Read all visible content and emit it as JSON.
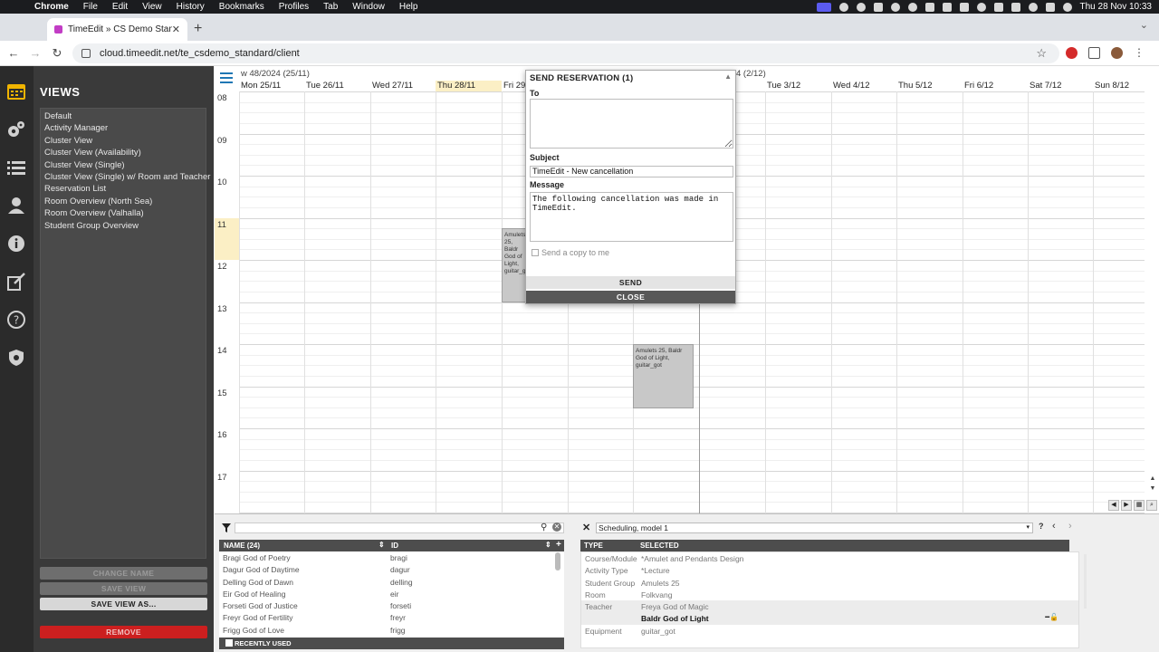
{
  "menubar": {
    "app": "Chrome",
    "items": [
      "File",
      "Edit",
      "View",
      "History",
      "Bookmarks",
      "Profiles",
      "Tab",
      "Window",
      "Help"
    ],
    "datetime": "Thu 28 Nov  10:33"
  },
  "browser": {
    "tab_title": "TimeEdit » CS Demo Standar",
    "url": "cloud.timeedit.net/te_csdemo_standard/client"
  },
  "views_panel": {
    "title": "VIEWS",
    "items": [
      "Default",
      "Activity Manager",
      "Cluster View",
      "Cluster View (Availability)",
      "Cluster View (Single)",
      "Cluster View (Single) w/ Room and Teacher",
      "Reservation List",
      "Room Overview (North Sea)",
      "Room Overview (Valhalla)",
      "Student Group Overview"
    ],
    "buttons": {
      "change_name": "CHANGE NAME",
      "save_view": "SAVE VIEW",
      "save_view_as": "SAVE VIEW AS...",
      "remove": "REMOVE"
    }
  },
  "calendar": {
    "week_labels": [
      "w 48/2024 (25/11)",
      "4 (2/12)"
    ],
    "days": [
      "Mon 25/11",
      "Tue 26/11",
      "Wed 27/11",
      "Thu 28/11",
      "Fri 29/11",
      "",
      "",
      "",
      "Tue 3/12",
      "Wed 4/12",
      "Thu 5/12",
      "Fri 6/12",
      "Sat 7/12",
      "Sun 8/12"
    ],
    "today_index": 3,
    "hours": [
      "08",
      "09",
      "10",
      "11",
      "12",
      "13",
      "14",
      "15",
      "16",
      "17"
    ],
    "today_hour": "11",
    "bookings": [
      {
        "text": "Amulets 25, Baldr God of Light, guitar_got"
      },
      {
        "text": "Amulets 25, Baldr God of Light, guitar_got"
      }
    ]
  },
  "dialog": {
    "title": "SEND RESERVATION (1)",
    "to_label": "To",
    "to_value": "",
    "subject_label": "Subject",
    "subject_value": "TimeEdit - New cancellation",
    "message_label": "Message",
    "message_value": "The following cancellation was made in TimeEdit.",
    "copy_label": "Send a copy to me",
    "send_label": "SEND",
    "close_label": "CLOSE"
  },
  "object_list": {
    "header_name": "NAME (24)",
    "header_id": "ID",
    "rows": [
      {
        "name": "Bragi God of Poetry",
        "id": "bragi"
      },
      {
        "name": "Dagur God of Daytime",
        "id": "dagur"
      },
      {
        "name": "Delling God of Dawn",
        "id": "delling"
      },
      {
        "name": "Eir God of Healing",
        "id": "eir"
      },
      {
        "name": "Forseti God of Justice",
        "id": "forseti"
      },
      {
        "name": "Freyr God of Fertility",
        "id": "freyr"
      },
      {
        "name": "Frigg God of Love",
        "id": "frigg"
      }
    ],
    "recently_used": "RECENTLY USED"
  },
  "scheduling": {
    "model": "Scheduling, model 1",
    "header_type": "TYPE",
    "header_selected": "SELECTED",
    "rows": [
      {
        "type": "Course/Module",
        "value": "*Amulet and Pendants Design"
      },
      {
        "type": "Activity Type",
        "value": "*Lecture"
      },
      {
        "type": "Student Group",
        "value": "Amulets 25"
      },
      {
        "type": "Room",
        "value": "Folkvang"
      },
      {
        "type": "Teacher",
        "value": "Freya God of Magic"
      },
      {
        "type": "",
        "value": "Baldr God of Light"
      },
      {
        "type": "Equipment",
        "value": "guitar_got"
      }
    ]
  }
}
